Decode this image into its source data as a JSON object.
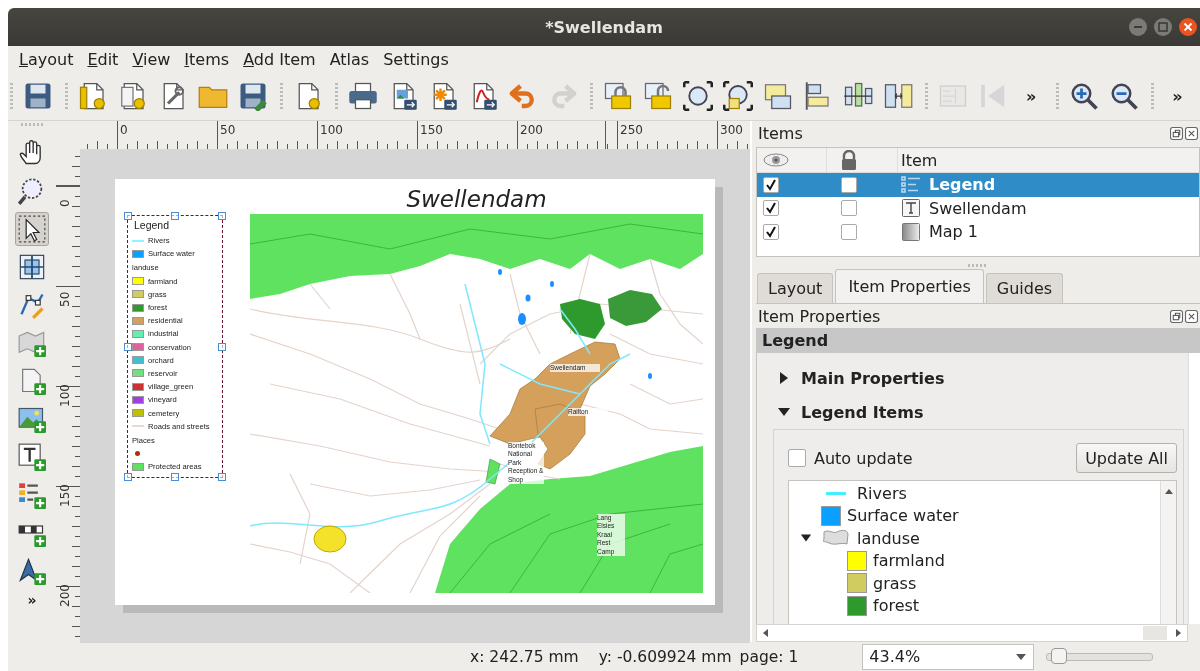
{
  "window": {
    "title": "*Swellendam"
  },
  "menu": [
    {
      "label": "Layout",
      "underline_first": true
    },
    {
      "label": "Edit",
      "underline_first": true
    },
    {
      "label": "View",
      "underline_first": true
    },
    {
      "label": "Items",
      "underline_first": true
    },
    {
      "label": "Add Item",
      "underline_first": true
    },
    {
      "label": "Atlas",
      "underline_first": false
    },
    {
      "label": "Settings",
      "underline_first": false
    }
  ],
  "toolbar": [
    {
      "items": [
        {
          "kind": "icon",
          "disabled": false
        }
      ]
    },
    {
      "items": [
        {
          "kind": "icon",
          "disabled": false
        },
        {
          "kind": "icon",
          "disabled": false
        },
        {
          "kind": "icon",
          "disabled": false
        },
        {
          "kind": "icon",
          "disabled": false
        },
        {
          "kind": "icon",
          "disabled": false
        }
      ]
    },
    {
      "items": [
        {
          "kind": "icon",
          "disabled": false
        }
      ]
    },
    {
      "items": [
        {
          "kind": "icon",
          "disabled": false
        },
        {
          "kind": "icon",
          "disabled": false
        },
        {
          "kind": "icon",
          "disabled": false
        },
        {
          "kind": "icon",
          "disabled": false
        },
        {
          "kind": "icon",
          "disabled": false
        },
        {
          "kind": "icon",
          "disabled": true
        }
      ]
    },
    {
      "items": [
        {
          "kind": "icon",
          "disabled": false
        },
        {
          "kind": "icon",
          "disabled": false
        },
        {
          "kind": "icon",
          "disabled": false
        },
        {
          "kind": "icon",
          "disabled": false
        },
        {
          "kind": "icon",
          "disabled": false
        },
        {
          "kind": "icon",
          "disabled": false
        },
        {
          "kind": "icon",
          "disabled": false
        },
        {
          "kind": "icon",
          "disabled": false
        }
      ]
    },
    {
      "items": [
        {
          "kind": "icon",
          "disabled": true
        },
        {
          "kind": "icon",
          "disabled": true
        },
        {
          "kind": "overflow",
          "label": "»"
        }
      ]
    },
    {
      "items": [
        {
          "kind": "icon",
          "disabled": false
        },
        {
          "kind": "icon",
          "disabled": false
        }
      ]
    },
    {
      "items": [
        {
          "kind": "overflow",
          "label": "»"
        }
      ]
    }
  ],
  "tools": [
    {
      "kind": "icon",
      "selected": false
    },
    {
      "kind": "icon",
      "selected": false
    },
    {
      "kind": "icon",
      "selected": true
    },
    {
      "kind": "icon",
      "selected": false
    },
    {
      "kind": "icon",
      "selected": false
    },
    {
      "kind": "icon",
      "selected": false
    },
    {
      "kind": "icon",
      "selected": false
    },
    {
      "kind": "icon",
      "selected": false
    },
    {
      "kind": "icon",
      "selected": false
    },
    {
      "kind": "icon",
      "selected": false
    },
    {
      "kind": "icon",
      "selected": false
    },
    {
      "kind": "icon",
      "selected": false
    },
    {
      "kind": "overflow",
      "label": "»"
    }
  ],
  "rulers": {
    "horizontal": [
      "0",
      "50",
      "100",
      "150",
      "200",
      "250",
      "300"
    ],
    "vertical": [
      "0",
      "50",
      "100",
      "150",
      "200"
    ]
  },
  "layout_page": {
    "title": "Swellendam",
    "legend": {
      "title": "Legend",
      "items": [
        {
          "kind": "line",
          "label": "Rivers",
          "color": "#8ff4ff"
        },
        {
          "kind": "patch",
          "label": "Surface water",
          "color": "#0aa0ff"
        },
        {
          "kind": "group",
          "label": "landuse"
        },
        {
          "kind": "patch",
          "label": "farmland",
          "color": "#ffff00"
        },
        {
          "kind": "patch",
          "label": "grass",
          "color": "#d0cc60"
        },
        {
          "kind": "patch",
          "label": "forest",
          "color": "#2e9a2e"
        },
        {
          "kind": "patch",
          "label": "residential",
          "color": "#d4a060"
        },
        {
          "kind": "patch",
          "label": "industrial",
          "color": "#60f0b0"
        },
        {
          "kind": "patch",
          "label": "conservation",
          "color": "#e060a0"
        },
        {
          "kind": "patch",
          "label": "orchard",
          "color": "#40c0d0"
        },
        {
          "kind": "patch",
          "label": "reservoir",
          "color": "#70e080"
        },
        {
          "kind": "patch",
          "label": "village_green",
          "color": "#d03030"
        },
        {
          "kind": "patch",
          "label": "vineyard",
          "color": "#a040e0"
        },
        {
          "kind": "patch",
          "label": "cemetery",
          "color": "#c0c000"
        },
        {
          "kind": "line",
          "label": "Roads and streets",
          "color": "#e8d8d0"
        },
        {
          "kind": "group",
          "label": "Places"
        },
        {
          "kind": "point",
          "color": "#b03000"
        },
        {
          "kind": "patch",
          "label": "Protected areas",
          "color": "#60e060"
        }
      ]
    },
    "map": {
      "labels": [
        "Swellendam",
        "Railton",
        "Bontebok National Park Reception & Shop",
        "Lang Elsies Kraal Rest Camp"
      ]
    }
  },
  "items_panel": {
    "title": "Items",
    "column_header": "Item",
    "rows": [
      {
        "name": "Legend",
        "kind": "legend",
        "visible": true,
        "locked": false,
        "selected": true
      },
      {
        "name": "Swellendam",
        "kind": "label",
        "visible": true,
        "locked": false,
        "selected": false
      },
      {
        "name": "Map 1",
        "kind": "map",
        "visible": true,
        "locked": false,
        "selected": false
      }
    ]
  },
  "tabs": [
    {
      "label": "Layout",
      "selected": false
    },
    {
      "label": "Item Properties",
      "selected": true
    },
    {
      "label": "Guides",
      "selected": false
    }
  ],
  "properties": {
    "title": "Item Properties",
    "item_type": "Legend",
    "sections": [
      {
        "label": "Main Properties",
        "expanded": false
      },
      {
        "label": "Legend Items",
        "expanded": true
      }
    ],
    "auto_update": {
      "label": "Auto update",
      "checked": false
    },
    "update_button": "Update All",
    "tree": [
      {
        "kind": "line",
        "label": "Rivers",
        "color": "#40f0ff"
      },
      {
        "kind": "patch",
        "label": "Surface water",
        "color": "#0aa0ff"
      },
      {
        "kind": "group",
        "label": "landuse",
        "expanded": true,
        "children": [
          {
            "kind": "patch",
            "label": "farmland",
            "color": "#ffff00"
          },
          {
            "kind": "patch",
            "label": "grass",
            "color": "#d0cc60"
          },
          {
            "kind": "patch",
            "label": "forest",
            "color": "#2e9a2e"
          }
        ]
      }
    ]
  },
  "status_bar": {
    "x": "x: 242.75 mm",
    "y": "y: -0.609924 mm",
    "page": "page: 1",
    "zoom": "43.4%",
    "zoom_slider": {
      "level": 0.04
    }
  }
}
